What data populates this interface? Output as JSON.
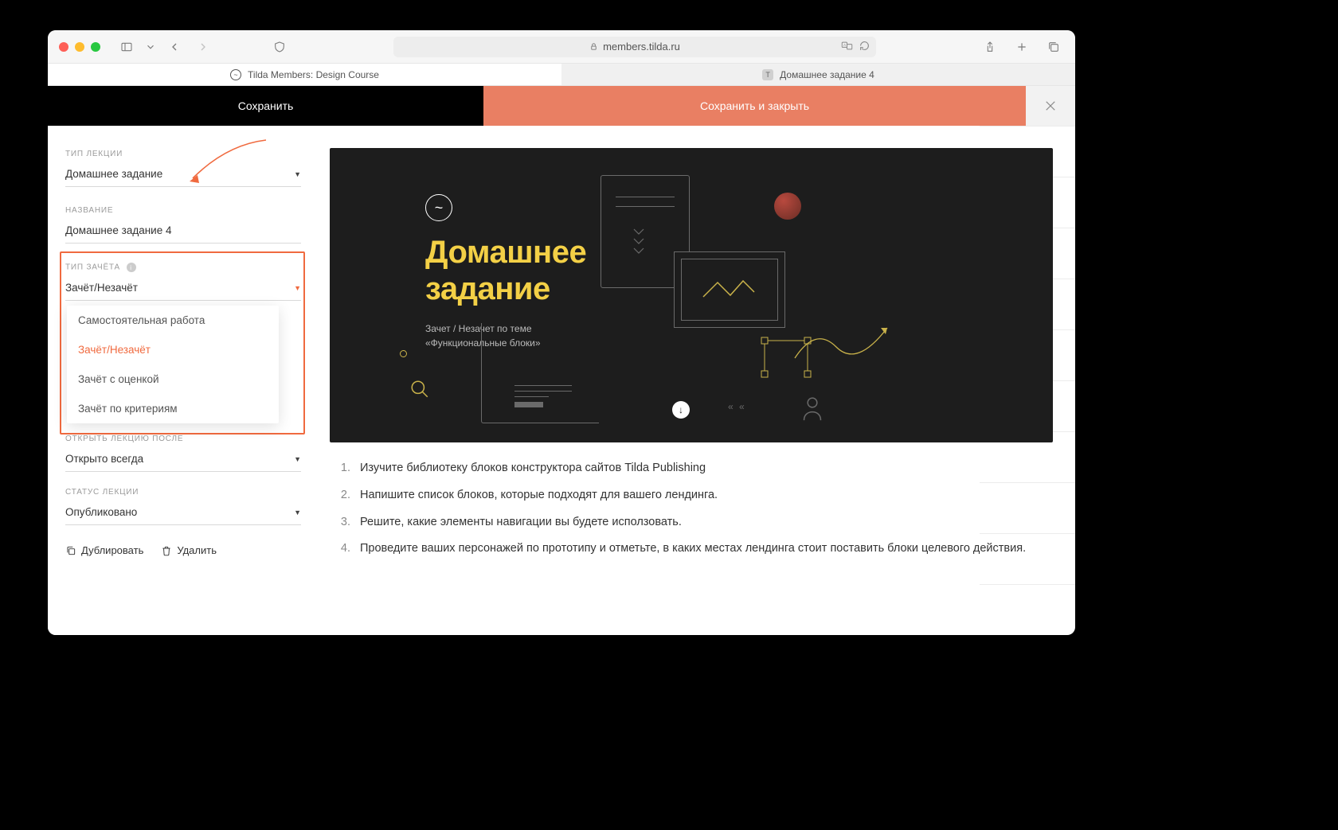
{
  "browser": {
    "url": "members.tilda.ru",
    "tabs": [
      {
        "title": "Tilda Members: Design Course"
      },
      {
        "title": "Домашнее задание 4"
      }
    ]
  },
  "actionbar": {
    "save": "Сохранить",
    "save_close": "Сохранить и закрыть"
  },
  "sidebar": {
    "lecture_type_label": "ТИП ЛЕКЦИИ",
    "lecture_type_value": "Домашнее задание",
    "title_label": "НАЗВАНИЕ",
    "title_value": "Домашнее задание 4",
    "grading_label": "ТИП ЗАЧЁТА",
    "grading_value": "Зачёт/Незачёт",
    "grading_options": [
      "Самостоятельная работа",
      "Зачёт/Незачёт",
      "Зачёт с оценкой",
      "Зачёт по критериям"
    ],
    "open_after_label": "ОТКРЫТЬ ЛЕКЦИЮ ПОСЛЕ",
    "open_after_value": "Открыто всегда",
    "status_label": "СТАТУС ЛЕКЦИИ",
    "status_value": "Опубликовано",
    "duplicate": "Дублировать",
    "delete": "Удалить"
  },
  "hero": {
    "title1": "Домашнее",
    "title2": "задание",
    "sub1": "Зачет / Незачет по теме",
    "sub2": "«Функциональные блоки»"
  },
  "instructions": [
    "Изучите библиотеку блоков конструктора сайтов Tilda Publishing",
    "Напишите список блоков, которые подходят для вашего лендинга.",
    "Решите, какие элементы навигации вы будете исползовать.",
    "Проведите ваших персонажей по прототипу и отметьте, в каких местах лендинга стоит поставить блоки целевого действия."
  ]
}
